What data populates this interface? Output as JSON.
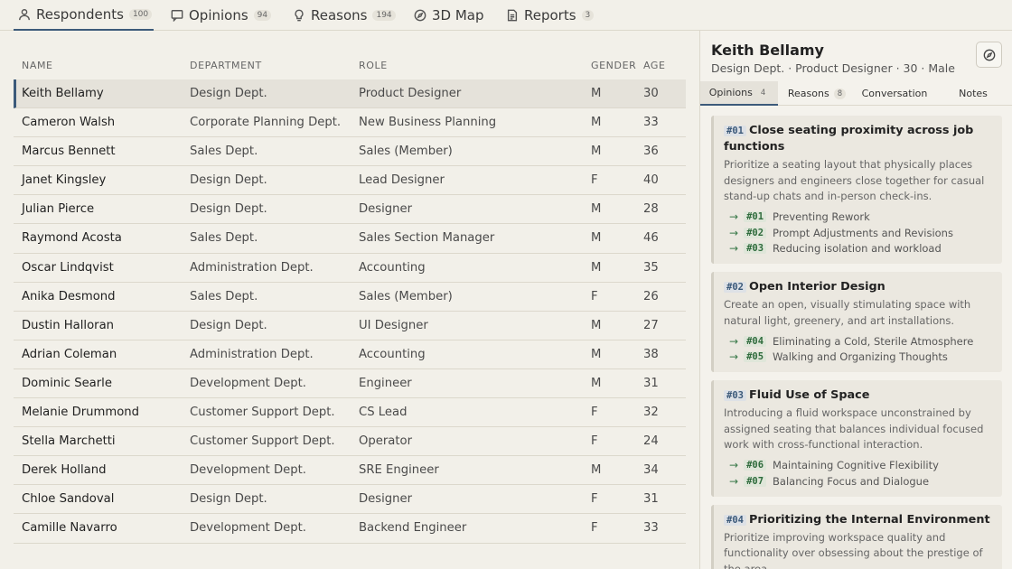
{
  "tabs": [
    {
      "label": "Respondents",
      "count": "100",
      "icon": "user-icon"
    },
    {
      "label": "Opinions",
      "count": "94",
      "icon": "message-icon"
    },
    {
      "label": "Reasons",
      "count": "194",
      "icon": "lightbulb-icon"
    },
    {
      "label": "3D Map",
      "icon": "compass-icon"
    },
    {
      "label": "Reports",
      "count": "3",
      "icon": "document-icon"
    }
  ],
  "table": {
    "headers": {
      "name": "NAME",
      "department": "DEPARTMENT",
      "role": "ROLE",
      "gender": "GENDER",
      "age": "AGE"
    },
    "rows": [
      {
        "name": "Keith Bellamy",
        "department": "Design Dept.",
        "role": "Product Designer",
        "gender": "M",
        "age": "30"
      },
      {
        "name": "Cameron Walsh",
        "department": "Corporate Planning Dept.",
        "role": "New Business Planning",
        "gender": "M",
        "age": "33"
      },
      {
        "name": "Marcus Bennett",
        "department": "Sales Dept.",
        "role": "Sales (Member)",
        "gender": "M",
        "age": "36"
      },
      {
        "name": "Janet Kingsley",
        "department": "Design Dept.",
        "role": "Lead Designer",
        "gender": "F",
        "age": "40"
      },
      {
        "name": "Julian Pierce",
        "department": "Design Dept.",
        "role": "Designer",
        "gender": "M",
        "age": "28"
      },
      {
        "name": "Raymond Acosta",
        "department": "Sales Dept.",
        "role": "Sales Section Manager",
        "gender": "M",
        "age": "46"
      },
      {
        "name": "Oscar Lindqvist",
        "department": "Administration Dept.",
        "role": "Accounting",
        "gender": "M",
        "age": "35"
      },
      {
        "name": "Anika Desmond",
        "department": "Sales Dept.",
        "role": "Sales (Member)",
        "gender": "F",
        "age": "26"
      },
      {
        "name": "Dustin Halloran",
        "department": "Design Dept.",
        "role": "UI Designer",
        "gender": "M",
        "age": "27"
      },
      {
        "name": "Adrian Coleman",
        "department": "Administration Dept.",
        "role": "Accounting",
        "gender": "M",
        "age": "38"
      },
      {
        "name": "Dominic Searle",
        "department": "Development Dept.",
        "role": "Engineer",
        "gender": "M",
        "age": "31"
      },
      {
        "name": "Melanie Drummond",
        "department": "Customer Support Dept.",
        "role": "CS Lead",
        "gender": "F",
        "age": "32"
      },
      {
        "name": "Stella Marchetti",
        "department": "Customer Support Dept.",
        "role": "Operator",
        "gender": "F",
        "age": "24"
      },
      {
        "name": "Derek Holland",
        "department": "Development Dept.",
        "role": "SRE Engineer",
        "gender": "M",
        "age": "34"
      },
      {
        "name": "Chloe Sandoval",
        "department": "Design Dept.",
        "role": "Designer",
        "gender": "F",
        "age": "31"
      },
      {
        "name": "Camille Navarro",
        "department": "Development Dept.",
        "role": "Backend Engineer",
        "gender": "F",
        "age": "33"
      }
    ]
  },
  "panel": {
    "name": "Keith Bellamy",
    "subtitle": "Design Dept. · Product Designer · 30 · Male",
    "tabs": [
      {
        "label": "Opinions",
        "count": "4"
      },
      {
        "label": "Reasons",
        "count": "8"
      },
      {
        "label": "Conversation"
      },
      {
        "label": "Notes"
      }
    ],
    "opinions": [
      {
        "id": "#01",
        "title": "Close seating proximity across job functions",
        "description": "Prioritize a seating layout that physically places designers and engineers close together for casual stand-up chats and in-person check-ins.",
        "reasons": [
          {
            "id": "#01",
            "label": "Preventing Rework"
          },
          {
            "id": "#02",
            "label": "Prompt Adjustments and Revisions"
          },
          {
            "id": "#03",
            "label": "Reducing isolation and workload"
          }
        ]
      },
      {
        "id": "#02",
        "title": "Open Interior Design",
        "description": "Create an open, visually stimulating space with natural light, greenery, and art installations.",
        "reasons": [
          {
            "id": "#04",
            "label": "Eliminating a Cold, Sterile Atmosphere"
          },
          {
            "id": "#05",
            "label": "Walking and Organizing Thoughts"
          }
        ]
      },
      {
        "id": "#03",
        "title": "Fluid Use of Space",
        "description": "Introducing a fluid workspace unconstrained by assigned seating that balances individual focused work with cross-functional interaction.",
        "reasons": [
          {
            "id": "#06",
            "label": "Maintaining Cognitive Flexibility"
          },
          {
            "id": "#07",
            "label": "Balancing Focus and Dialogue"
          }
        ]
      },
      {
        "id": "#04",
        "title": "Prioritizing the Internal Environment",
        "description": "Prioritize improving workspace quality and functionality over obsessing about the prestige of the area",
        "reasons": []
      }
    ]
  },
  "colors": {
    "accent": "#3c5a7a",
    "background": "#f2f0e9",
    "reason_green": "#2f6b3c"
  }
}
